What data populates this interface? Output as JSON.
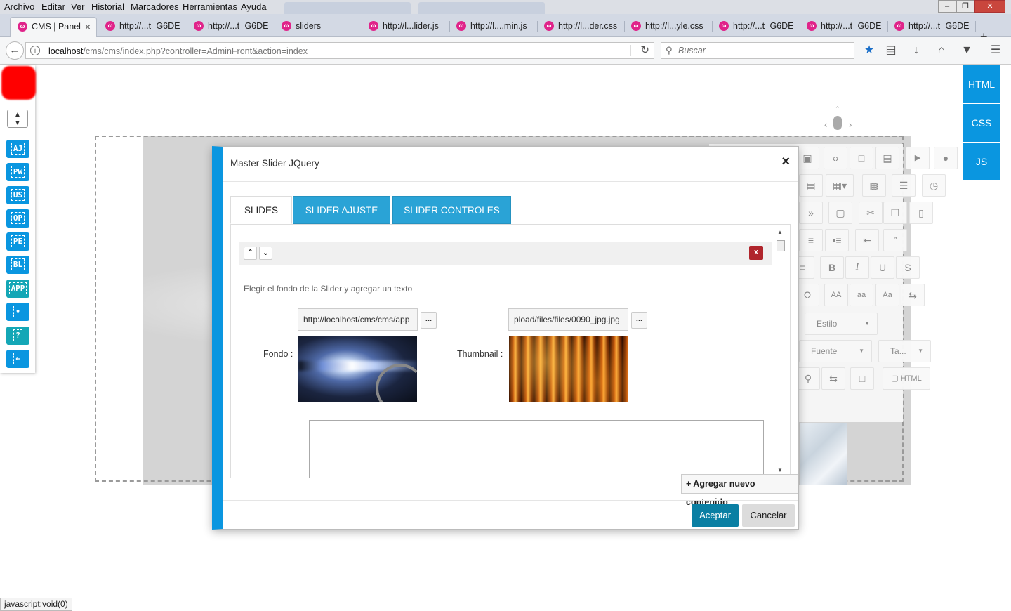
{
  "menubar": {
    "items": [
      "Archivo",
      "Editar",
      "Ver",
      "Historial",
      "Marcadores",
      "Herramientas",
      "Ayuda"
    ]
  },
  "tabs": [
    {
      "label": "CMS | Panel",
      "active": true
    },
    {
      "label": "http://...t=G6DE"
    },
    {
      "label": "http://...t=G6DE"
    },
    {
      "label": "sliders"
    },
    {
      "label": "http://l...lider.js"
    },
    {
      "label": "http://l....min.js"
    },
    {
      "label": "http://l...der.css"
    },
    {
      "label": "http://l...yle.css"
    },
    {
      "label": "http://...t=G6DE"
    },
    {
      "label": "http://...t=G6DE"
    },
    {
      "label": "http://...t=G6DE"
    }
  ],
  "navbar": {
    "url_host": "localhost",
    "url_path": "/cms/cms/index.php?controller=AdminFront&action=index",
    "search_placeholder": "Buscar"
  },
  "sidebar": {
    "buttons": [
      "AJ",
      "PW",
      "US",
      "OP",
      "PE",
      "BL",
      "APP",
      "•",
      "?",
      "←"
    ]
  },
  "code_buttons": [
    "HTML",
    "CSS",
    "JS"
  ],
  "editor_toolbar": {
    "style_dropdown": "Estilo",
    "font_dropdown": "Fuente",
    "size_dropdown": "Ta...",
    "html_button": "HTML",
    "case_buttons": [
      "AA",
      "aa",
      "Aa"
    ]
  },
  "modal": {
    "title": "Master Slider JQuery",
    "tabs": [
      "SLIDES",
      "SLIDER AJUSTE",
      "SLIDER CONTROLES"
    ],
    "slide": {
      "description": "Elegir el fondo de la Slider y agregar un texto",
      "fondo_label": "Fondo :",
      "fondo_value": "http://localhost/cms/cms/app",
      "thumbnail_label": "Thumbnail :",
      "thumbnail_value": "pload/files/files/0090_jpg.jpg",
      "browse_label": "...",
      "remove_label": "x"
    },
    "add_content": "+ Agregar nuevo contenido",
    "accept": "Aceptar",
    "cancel": "Cancelar"
  },
  "status_text": "javascript:void(0)",
  "colors": {
    "accent_blue": "#0a96e0",
    "tab_blue": "#2aa3d6",
    "ok_button": "#0a7fa3",
    "danger": "#b0252c"
  }
}
